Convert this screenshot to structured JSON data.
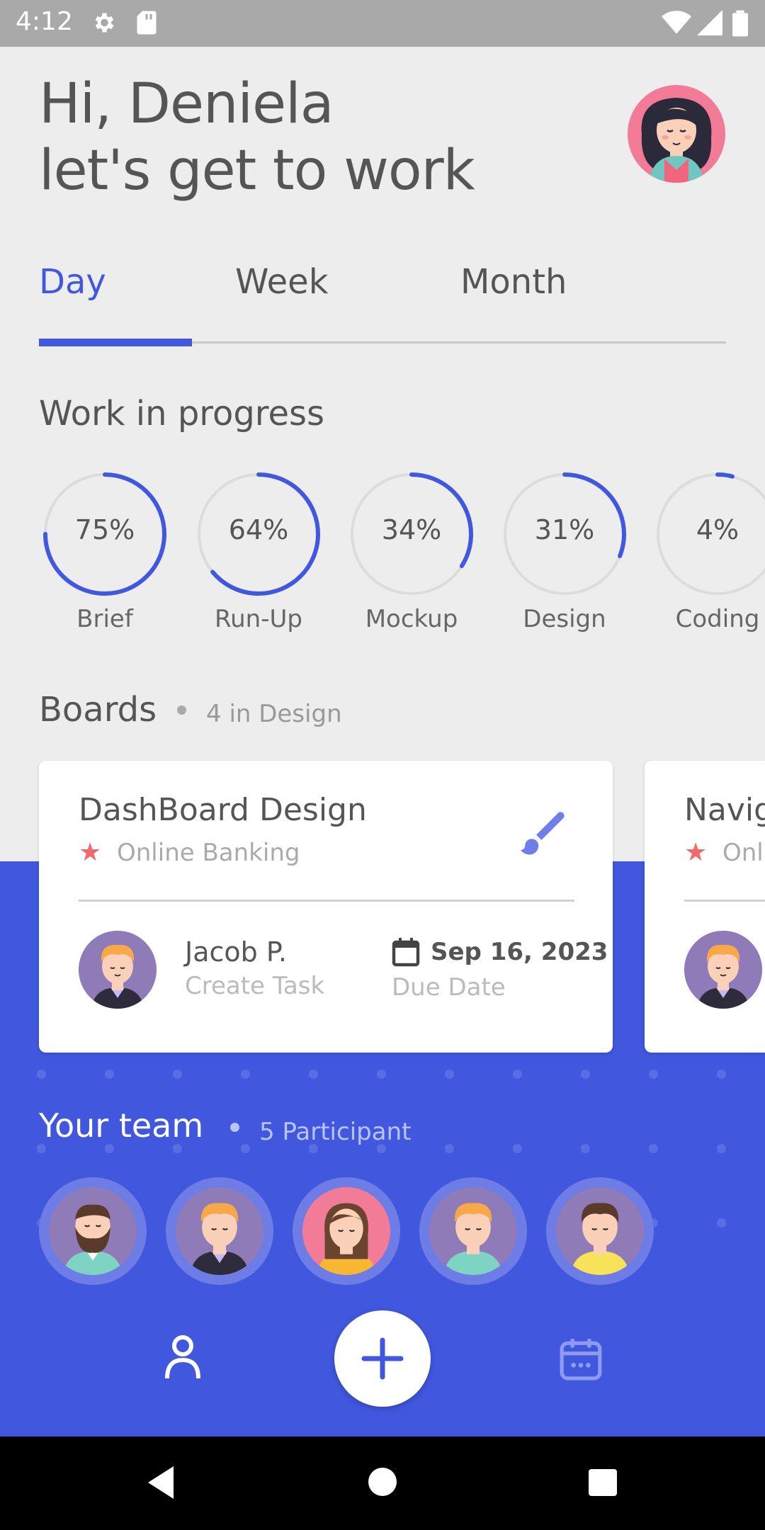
{
  "status_bar": {
    "time": "4:12"
  },
  "greeting": {
    "line1": "Hi, Deniela",
    "line2": "let's get to work"
  },
  "tabs": [
    {
      "label": "Day",
      "active": true
    },
    {
      "label": "Week",
      "active": false
    },
    {
      "label": "Month",
      "active": false
    }
  ],
  "progress": {
    "title": "Work in progress",
    "items": [
      {
        "label": "Brief",
        "percent_text": "75%",
        "percent": 75
      },
      {
        "label": "Run-Up",
        "percent_text": "64%",
        "percent": 64
      },
      {
        "label": "Mockup",
        "percent_text": "34%",
        "percent": 34
      },
      {
        "label": "Design",
        "percent_text": "31%",
        "percent": 31
      },
      {
        "label": "Coding",
        "percent_text": "4%",
        "percent": 4
      }
    ]
  },
  "boards": {
    "title": "Boards",
    "subtitle": "4 in Design",
    "cards": [
      {
        "title": "DashBoard Design",
        "category": "Online Banking",
        "assignee": "Jacob P.",
        "assignee_role": "Create Task",
        "date": "Sep 16, 2023",
        "date_label": "Due Date",
        "icon": "paint-brush-icon"
      },
      {
        "title": "Navig",
        "category": "Onli",
        "icon": "paint-brush-icon"
      }
    ]
  },
  "team": {
    "title": "Your team",
    "count": "5 Participant"
  },
  "colors": {
    "accent": "#4157DD",
    "star": "#EF6B6B",
    "background": "#EEEDEE"
  }
}
